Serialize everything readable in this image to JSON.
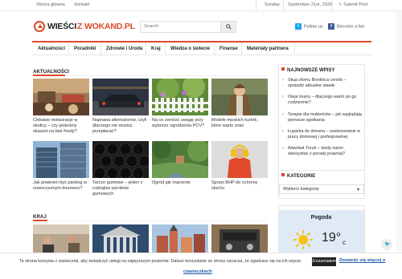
{
  "topbar": {
    "links": [
      "Strona główna",
      "Kontakt"
    ],
    "day": "Sunday",
    "date": "September 21st, 2025",
    "submit": "Submit Post"
  },
  "logo": {
    "part1": "WIEŚCI",
    "part2": "Z WOKAND.PL"
  },
  "search": {
    "placeholder": "Search"
  },
  "social": {
    "twitter": "Follow us",
    "facebook": "Become a fan"
  },
  "nav": [
    "Aktualności",
    "Poradniki",
    "Zdrowie i Uroda",
    "Kraj",
    "Wiedza o świecie",
    "Finanse",
    "Materiały partnera"
  ],
  "sections": {
    "news": "AKTUALNOŚCI",
    "country": "KRAJ"
  },
  "news_cards": [
    "Ciekawe restauracje w okolicy – czy jesteśmy skazani na fast foody?",
    "Naprawa alternatorów, czyli dlaczego nie musisz przepłacać?",
    "Na co zwrócić uwagę przy wyborze ogrodzenia PCV?",
    "Modele męskich kurtek, które warto znać",
    "Jak powinien być parking w nowoczesnym biurowcu?",
    "Tarcze gumowe – jeden z rodzajów wyrobów gumowych",
    "Ogród jak marzenie",
    "Sprzęt BHP do ochrony słuchu"
  ],
  "sidebar": {
    "latest_title": "NAJNOWSZE WPISY",
    "latest": [
      "Skup złomu Brodnica cennik – sprawdź aktualne stawki",
      "Oleje lniany – dlaczego warto po go codziennie?",
      "Terapie dla małżeństw – jak wyglądają pierwsze spotkania",
      "Łuparka do drewna – zastosowanie w pracy domowej i profesjonalnej",
      "Adwokat Toruń – kiedy warto skorzystać z porady prawnej?"
    ],
    "categories_title": "KATEGORIE",
    "categories_select": "Wybierz kategorię"
  },
  "weather": {
    "title": "Pogoda",
    "temp": "19°",
    "unit": "c"
  },
  "cookie": {
    "text": "Ta strona korzysta z ciasteczek, aby świadczyć usługi na najwyższym poziomie. Dalsze korzystanie ze strony oznacza, że zgadzasz się na ich użycie.",
    "accept": "Zrozumiałem",
    "more_a": "Dowiedz się więcej o",
    "more_b": "ciasteczkach"
  }
}
